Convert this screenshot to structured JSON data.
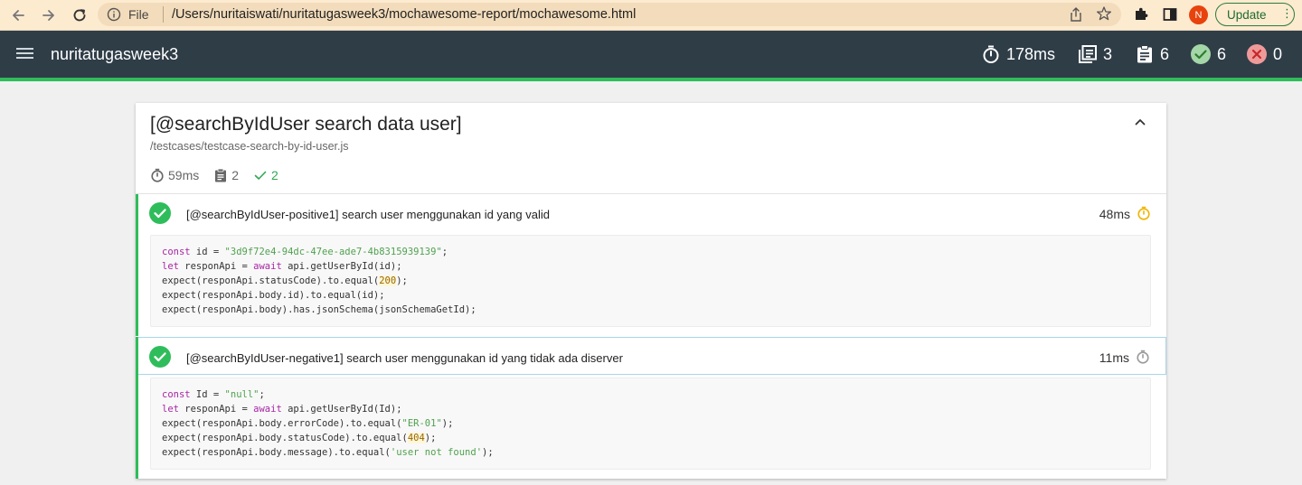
{
  "browser": {
    "file_label": "File",
    "url": "/Users/nuritaiswati/nuritatugasweek3/mochawesome-report/mochawesome.html",
    "profile_initial": "N",
    "update_label": "Update"
  },
  "navbar": {
    "title": "nuritatugasweek3",
    "duration": "178ms",
    "suites": "3",
    "tests": "6",
    "passed": "6",
    "failed": "0"
  },
  "suite": {
    "title": "[@searchByIdUser search data user]",
    "file": "/testcases/testcase-search-by-id-user.js",
    "duration": "59ms",
    "tests": "2",
    "passed": "2",
    "tests_list": [
      {
        "title": "[@searchByIdUser-positive1] search user menggunakan id yang valid",
        "duration": "48ms",
        "timer_color": "#f0b400",
        "code": [
          [
            {
              "t": "const",
              "c": "kw"
            },
            {
              "t": " id = "
            },
            {
              "t": "\"3d9f72e4-94dc-47ee-ade7-4b8315939139\"",
              "c": "str"
            },
            {
              "t": ";"
            }
          ],
          [
            {
              "t": "let",
              "c": "kw"
            },
            {
              "t": " responApi = "
            },
            {
              "t": "await",
              "c": "kw"
            },
            {
              "t": " api.getUserById(id);"
            }
          ],
          [
            {
              "t": "expect(responApi.statusCode).to.equal("
            },
            {
              "t": "200",
              "c": "num"
            },
            {
              "t": ");"
            }
          ],
          [
            {
              "t": "expect(responApi.body.id).to.equal(id);"
            }
          ],
          [
            {
              "t": "expect(responApi.body).has.jsonSchema(jsonSchemaGetId);"
            }
          ]
        ]
      },
      {
        "title": "[@searchByIdUser-negative1] search user menggunakan id yang tidak ada diserver",
        "duration": "11ms",
        "timer_color": "#9a9a9a",
        "code": [
          [
            {
              "t": "const",
              "c": "kw"
            },
            {
              "t": " Id = "
            },
            {
              "t": "\"null\"",
              "c": "str"
            },
            {
              "t": ";"
            }
          ],
          [
            {
              "t": "let",
              "c": "kw"
            },
            {
              "t": " responApi = "
            },
            {
              "t": "await",
              "c": "kw"
            },
            {
              "t": " api.getUserById(Id);"
            }
          ],
          [
            {
              "t": "expect(responApi.body.errorCode).to.equal("
            },
            {
              "t": "\"ER-01\"",
              "c": "str"
            },
            {
              "t": ");"
            }
          ],
          [
            {
              "t": "expect(responApi.body.statusCode).to.equal("
            },
            {
              "t": "404",
              "c": "num"
            },
            {
              "t": ");"
            }
          ],
          [
            {
              "t": "expect(responApi.body.message).to.equal("
            },
            {
              "t": "'user not found'",
              "c": "str"
            },
            {
              "t": ");"
            }
          ]
        ]
      }
    ]
  },
  "colors": {
    "navbar_bg": "#2f3d47",
    "pass_green": "#2fbd5b",
    "fail_red": "#e53935",
    "browser_bg": "#fdebd0"
  },
  "icons": {
    "back": "arrow-left-icon",
    "forward": "arrow-right-icon",
    "reload": "reload-icon",
    "menu": "hamburger-icon",
    "duration": "stopwatch-icon",
    "suites": "library-books-icon",
    "tests": "clipboard-icon",
    "passed": "check-circle-icon",
    "failed": "close-circle-icon"
  }
}
